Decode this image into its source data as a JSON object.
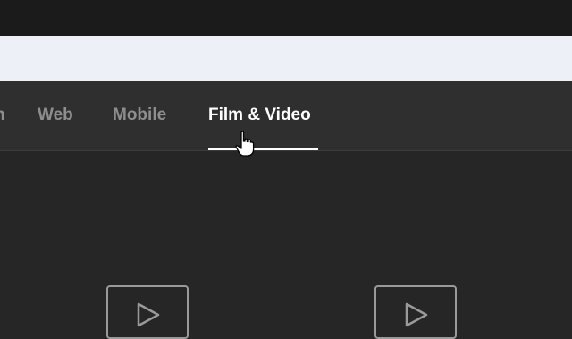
{
  "tabs": {
    "partial_label": "n",
    "items": [
      {
        "label": "Web"
      },
      {
        "label": "Mobile"
      },
      {
        "label": "Film & Video"
      }
    ],
    "active_index": 2
  },
  "icons": {
    "cursor": "hand-pointer-icon",
    "card_icon": "play-icon"
  },
  "colors": {
    "background": "#262626",
    "tab_bar": "#2f2f2f",
    "address_bar": "#eef0f7",
    "active_tab": "#ffffff",
    "inactive_tab": "#8e8e8e"
  }
}
